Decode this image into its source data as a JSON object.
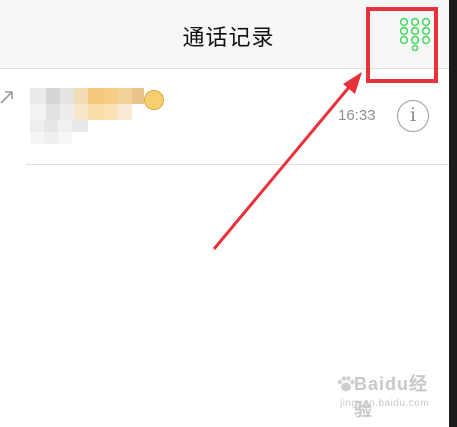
{
  "header": {
    "title": "通话记录",
    "dialpad_icon": "keypad-icon",
    "accent_color": "#4cd964"
  },
  "annotation": {
    "highlight_color": "#e8313a"
  },
  "calls": [
    {
      "direction_icon": "outgoing-call-icon",
      "name_redacted": true,
      "time": "16:33",
      "info_icon": "info-icon",
      "info_glyph": "i"
    }
  ],
  "watermark": {
    "brand": "Baidu经验",
    "url": "jingyan.baidu.com"
  }
}
